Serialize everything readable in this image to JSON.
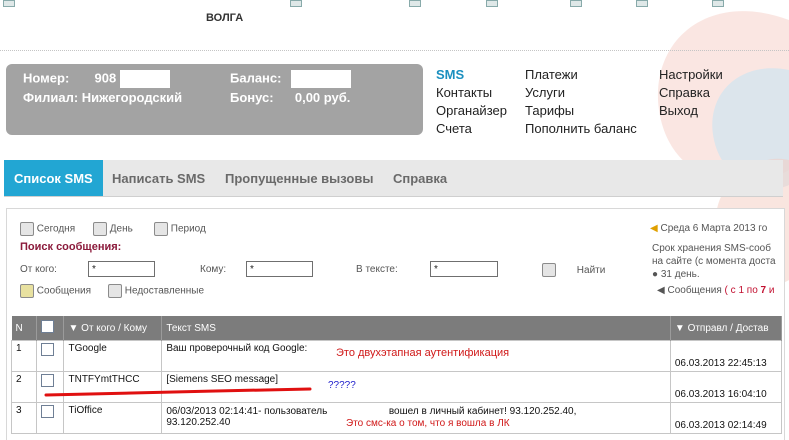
{
  "header": {
    "region": "ВОЛГА"
  },
  "account": {
    "number_label": "Номер:",
    "number_value": "908",
    "branch_label": "Филиал:",
    "branch_value": "Нижегородский",
    "balance_label": "Баланс:",
    "bonus_label": "Бонус:",
    "bonus_value": "0,00 руб."
  },
  "nav": {
    "col1": [
      "SMS",
      "Контакты",
      "Органайзер",
      "Счета"
    ],
    "col2": [
      "Платежи",
      "Услуги",
      "Тарифы",
      "Пополнить баланс"
    ],
    "col3": [
      "Настройки",
      "Справка",
      "Выход"
    ]
  },
  "tabs": [
    "Список SMS",
    "Написать SMS",
    "Пропущенные вызовы",
    "Справка"
  ],
  "filters": {
    "today": "Сегодня",
    "day": "День",
    "period": "Период",
    "search_heading": "Поиск сообщения:",
    "from_label": "От кого:",
    "from_value": "*",
    "to_label": "Кому:",
    "to_value": "*",
    "text_label": "В тексте:",
    "text_value": "*",
    "find_button": "Найти",
    "messages": "Сообщения",
    "undelivered": "Недоставленные"
  },
  "side_info": {
    "date": "Среда 6 Марта 2013 го",
    "storage_1": "Срок хранения SMS-сооб",
    "storage_2": "на сайте (с момента доста",
    "storage_3": "31 день.",
    "messages_label": "Сообщения",
    "range_prefix": "( с ",
    "range_from": "1",
    "range_mid": " по ",
    "range_to": "7",
    "range_suffix": " и"
  },
  "table": {
    "headers": [
      "N",
      "",
      "От кого / Кому",
      "Текст SMS",
      "Отправл / Достав"
    ],
    "rows": [
      {
        "n": "1",
        "from": "TGoogle",
        "text": "Ваш проверочный код Google:",
        "text2": "",
        "date": "06.03.2013 22:45:13"
      },
      {
        "n": "2",
        "from": "TNTFYmtTHCC",
        "text": "[Siemens SEO message]",
        "text2": "",
        "date": "06.03.2013 16:04:10"
      },
      {
        "n": "3",
        "from": "TiOffice",
        "text": "06/03/2013 02:14:41- пользователь",
        "text_b": "вошел в личный кабинет! 93.120.252.40,",
        "text2": "93.120.252.40",
        "date": "06.03.2013 02:14:49"
      }
    ]
  },
  "annotations": {
    "two_factor": "Это двухэтапная аутентификация",
    "question": "?????",
    "sms_about_login": "Это смс-ка о том, что я вошла в ЛК"
  },
  "colors": {
    "tab_active": "#22a6d3",
    "info_box": "#a3a3a3",
    "annotation_red": "#d01818",
    "annotation_blue": "#2222cc",
    "link_active": "#1a8fbf"
  }
}
